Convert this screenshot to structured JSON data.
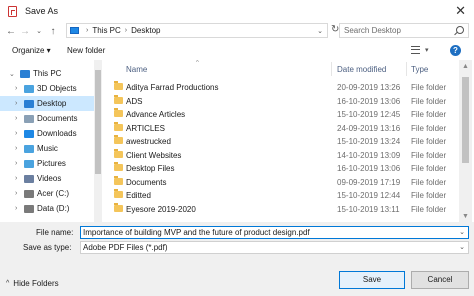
{
  "window": {
    "title": "Save As",
    "close_glyph": "✕"
  },
  "address": {
    "back_glyph": "←",
    "forward_glyph": "→",
    "recent_glyph": "⌄",
    "up_glyph": "↑",
    "path": [
      "This PC",
      "Desktop"
    ],
    "separator": "›",
    "dropdown_glyph": "⌄",
    "refresh_glyph": "↻",
    "search_placeholder": "Search Desktop"
  },
  "toolbar": {
    "organize_label": "Organize ▾",
    "new_folder_label": "New folder",
    "view_dropdown_glyph": "▾",
    "help_glyph": "?"
  },
  "nav": {
    "items": [
      {
        "label": "This PC",
        "icon": "computer-icon",
        "color": "#2a7fd4"
      },
      {
        "label": "3D Objects",
        "icon": "cube-icon",
        "color": "#4aa3df"
      },
      {
        "label": "Desktop",
        "icon": "desktop-icon",
        "color": "#2a7fd4",
        "selected": true
      },
      {
        "label": "Documents",
        "icon": "documents-icon",
        "color": "#8aa0b5"
      },
      {
        "label": "Downloads",
        "icon": "downloads-icon",
        "color": "#1e88e5"
      },
      {
        "label": "Music",
        "icon": "music-icon",
        "color": "#4aa3df"
      },
      {
        "label": "Pictures",
        "icon": "pictures-icon",
        "color": "#4aa3df"
      },
      {
        "label": "Videos",
        "icon": "videos-icon",
        "color": "#6b7fa0"
      },
      {
        "label": "Acer (C:)",
        "icon": "drive-icon",
        "color": "#7a7a7a"
      },
      {
        "label": "Data (D:)",
        "icon": "drive-icon",
        "color": "#7a7a7a"
      }
    ]
  },
  "list": {
    "columns": {
      "name": "Name",
      "date": "Date modified",
      "type": "Type"
    },
    "rows": [
      {
        "name": "Aditya Farrad Productions",
        "date": "20-09-2019 13:26",
        "type": "File folder"
      },
      {
        "name": "ADS",
        "date": "16-10-2019 13:06",
        "type": "File folder"
      },
      {
        "name": "Advance Articles",
        "date": "15-10-2019 12:45",
        "type": "File folder"
      },
      {
        "name": "ARTICLES",
        "date": "24-09-2019 13:16",
        "type": "File folder"
      },
      {
        "name": "awestrucked",
        "date": "15-10-2019 13:24",
        "type": "File folder"
      },
      {
        "name": "Client Websites",
        "date": "14-10-2019 13:09",
        "type": "File folder"
      },
      {
        "name": "Desktop Files",
        "date": "16-10-2019 13:06",
        "type": "File folder"
      },
      {
        "name": "Documents",
        "date": "09-09-2019 17:19",
        "type": "File folder"
      },
      {
        "name": "Editted",
        "date": "15-10-2019 12:44",
        "type": "File folder"
      },
      {
        "name": "Eyesore 2019-2020",
        "date": "15-10-2019 13:11",
        "type": "File folder"
      }
    ]
  },
  "save": {
    "file_name_label": "File name:",
    "file_name_value": "Importance of building MVP and the future of product design.pdf",
    "save_as_type_label": "Save as type:",
    "save_as_type_value": "Adobe PDF Files (*.pdf)",
    "dropdown_glyph": "⌄",
    "hide_folders_caret": "^",
    "hide_folders_label": "Hide Folders",
    "save_label": "Save",
    "cancel_label": "Cancel"
  },
  "colors": {
    "accent": "#0078d7",
    "selection": "#cce8ff",
    "folder": "#f4c55a"
  }
}
